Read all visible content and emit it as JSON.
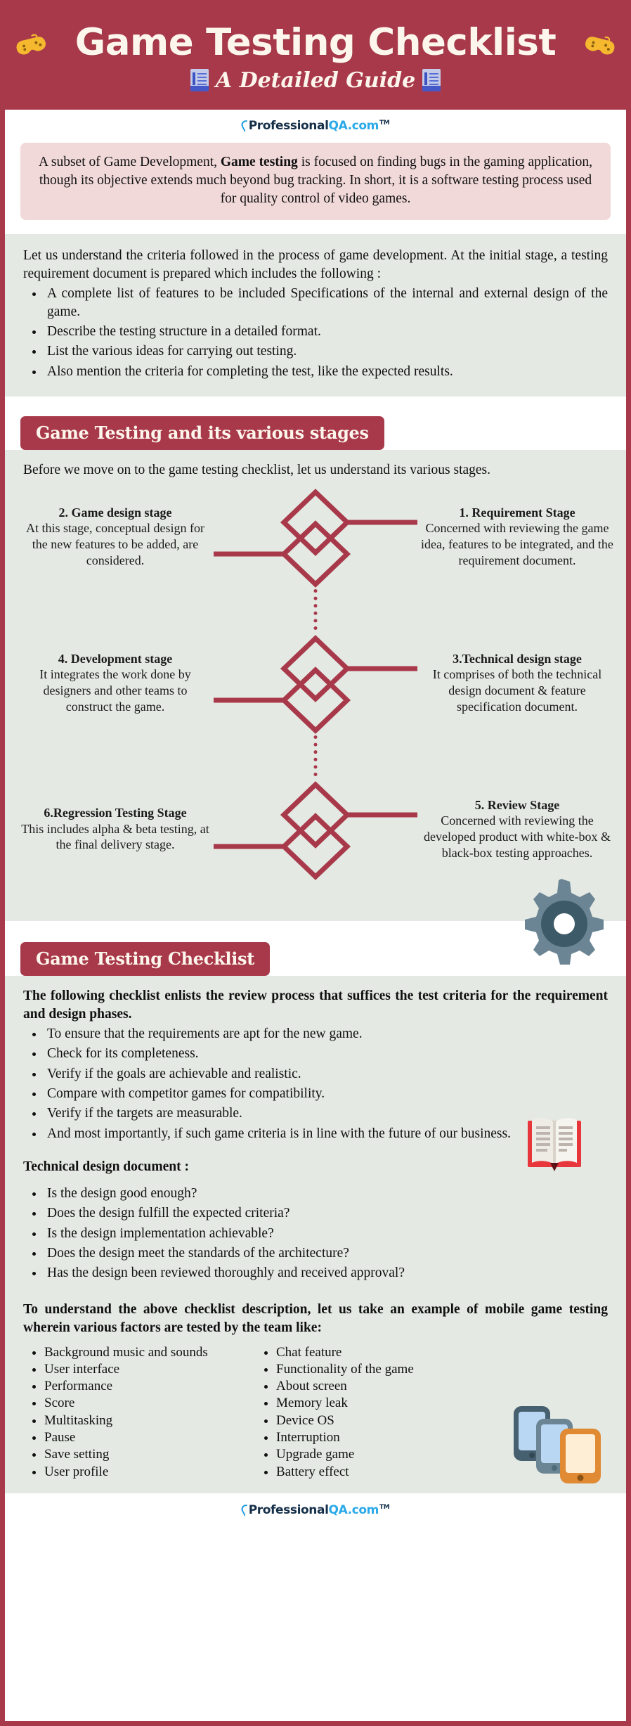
{
  "header": {
    "title": "Game Testing Checklist",
    "subtitle": "A Detailed Guide",
    "left_icon": "gamepad-icon",
    "right_icon": "gamepad-icon"
  },
  "logo": {
    "brand_dark": "Professional",
    "brand_blue": "QA.com",
    "tm": "TM"
  },
  "intro": {
    "text_before": "A subset of Game Development, ",
    "bold": "Game testing",
    "text_after": " is focused on finding bugs in the gaming application, though its objective extends much beyond bug tracking. In short, it is a software testing process used for quality control of video games."
  },
  "criteria": {
    "paragraph": "Let us understand the criteria followed in the process of game development. At the initial stage, a testing requirement document is prepared which includes the following :",
    "items": [
      "A complete list of features to be included Specifications of the internal and external design of the game.",
      "Describe the testing structure in a detailed format.",
      "List the various ideas for carrying out testing.",
      "Also mention the criteria for completing the test, like the expected results."
    ]
  },
  "stages_section": {
    "heading": "Game Testing and its various stages",
    "intro": "Before we move on to the game testing checklist, let us understand its various stages.",
    "rows": [
      {
        "left_title": "2. Game design stage",
        "left_body": "At this stage, conceptual design for the new features to be added, are considered.",
        "right_title": "1. Requirement Stage",
        "right_body": "Concerned with reviewing the game idea, features to be integrated, and the requirement document."
      },
      {
        "left_title": "4. Development stage",
        "left_body": "It integrates the work done by designers and other teams to construct the game.",
        "right_title": "3.Technical design stage",
        "right_body": "It comprises of both the technical design document & feature specification document."
      },
      {
        "left_title": "6.Regression Testing Stage",
        "left_body": "This includes alpha & beta testing, at the final delivery stage.",
        "right_title": "5. Review Stage",
        "right_body": "Concerned with reviewing the developed product with white-box & black-box testing approaches."
      }
    ]
  },
  "checklist_section": {
    "heading": "Game Testing Checklist",
    "lead": "The following checklist enlists the review process that suffices the test criteria for the requirement and design phases.",
    "items": [
      "To ensure that the requirements are apt for the new game.",
      "Check for its completeness.",
      "Verify if the goals are achievable and realistic.",
      "Compare with competitor games for compatibility.",
      "Verify if the targets are measurable.",
      "And most importantly, if such game criteria is in line with the future of our business."
    ],
    "tdd_heading": "Technical design document :",
    "tdd_items": [
      "Is the design good enough?",
      "Does the design fulfill the expected criteria?",
      "Is the design implementation achievable?",
      "Does the design meet the standards of the architecture?",
      "Has the design been reviewed thoroughly and received approval?"
    ],
    "example_lead": "To understand the above checklist description, let us take an example of mobile game testing wherein various factors are tested by the team like:",
    "factors_col1": [
      "Background music and sounds",
      "User interface",
      "Performance",
      "Score",
      "Multitasking",
      "Pause",
      "Save setting",
      "User profile"
    ],
    "factors_col2": [
      "Chat feature",
      "Functionality of the game",
      "About screen",
      "Memory leak",
      "Device OS",
      "Interruption",
      "Upgrade game",
      "Battery effect"
    ]
  },
  "colors": {
    "brand_red": "#a8394a",
    "panel_gray": "#e4e9e3",
    "intro_pink": "#f1d8d9",
    "gear_gray": "#6b8594",
    "logo_blue": "#2aa9e8"
  }
}
